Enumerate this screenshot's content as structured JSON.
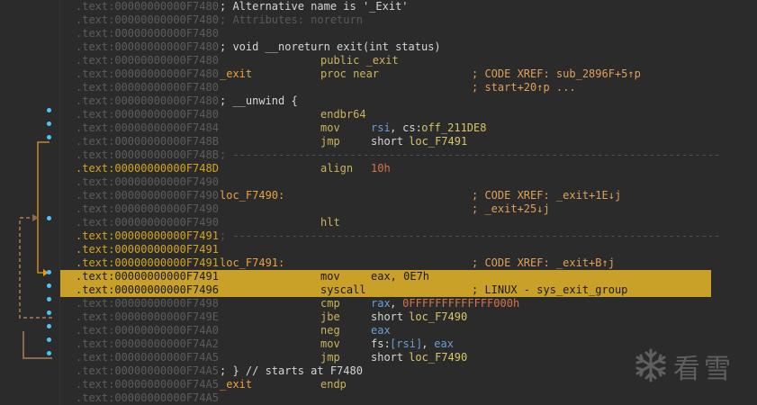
{
  "colors": {
    "background": "#2b2b2b",
    "address": "#5c5c5c",
    "address_highlight": "#d4a61c",
    "label": "#e8a23c",
    "register": "#6b9fd4",
    "number": "#d7724a",
    "highlight_bar": "#c9a028",
    "flow_dot": "#4fc3f7"
  },
  "rows": [
    {
      "addr": ".text:00000000000F7480",
      "a": "; Alternative name is '_Exit'"
    },
    {
      "addr": ".text:00000000000F7480",
      "a": "; Attributes: noreturn"
    },
    {
      "addr": ".text:00000000000F7480"
    },
    {
      "addr": ".text:00000000000F7480",
      "a": "; void __noreturn exit(int status)"
    },
    {
      "addr": ".text:00000000000F7480",
      "b": "public _exit"
    },
    {
      "addr": ".text:00000000000F7480",
      "a": "_exit",
      "b": "proc near",
      "d": "; CODE XREF: sub_2896F+5↑p"
    },
    {
      "addr": ".text:00000000000F7480",
      "d": "; start+20↑p ..."
    },
    {
      "addr": ".text:00000000000F7480",
      "a": "; __unwind {"
    },
    {
      "addr": ".text:00000000000F7480",
      "b": "endbr64"
    },
    {
      "addr": ".text:00000000000F7484",
      "b": "mov",
      "c1": "rsi",
      "c2": ", ",
      "c3": "cs:",
      "c4": "off_211DE8"
    },
    {
      "addr": ".text:00000000000F748B",
      "b": "jmp",
      "c1": "short ",
      "c2": "loc_F7491"
    },
    {
      "addr": ".text:00000000000F748B",
      "a": "; ---------------------------------------------------------------------------"
    },
    {
      "addr": ".text:00000000000F748D",
      "b": "align",
      "c1": "10h"
    },
    {
      "addr": ".text:00000000000F7490"
    },
    {
      "addr": ".text:00000000000F7490",
      "a": "loc_F7490:",
      "d": "; CODE XREF: _exit+1E↓j"
    },
    {
      "addr": ".text:00000000000F7490",
      "d": "; _exit+25↓j"
    },
    {
      "addr": ".text:00000000000F7490",
      "b": "hlt"
    },
    {
      "addr": ".text:00000000000F7491",
      "a": "; ---------------------------------------------------------------------------"
    },
    {
      "addr": ".text:00000000000F7491"
    },
    {
      "addr": ".text:00000000000F7491",
      "a": "loc_F7491:",
      "d": "; CODE XREF: _exit+B↑j"
    },
    {
      "addr": ".text:00000000000F7491",
      "b": "mov",
      "c1": "eax, 0E7h"
    },
    {
      "addr": ".text:00000000000F7496",
      "b": "syscall",
      "d": "; LINUX - sys_exit_group"
    },
    {
      "addr": ".text:00000000000F7498",
      "b": "cmp",
      "c1": "rax",
      "c2": ", ",
      "c3": "0FFFFFFFFFFFFF000h"
    },
    {
      "addr": ".text:00000000000F749E",
      "b": "jbe",
      "c1": "short ",
      "c2": "loc_F7490"
    },
    {
      "addr": ".text:00000000000F74A0",
      "b": "neg",
      "c1": "eax"
    },
    {
      "addr": ".text:00000000000F74A2",
      "b": "mov",
      "c1": "fs:",
      "c2": "[rsi]",
      "c3": ", ",
      "c4": "eax"
    },
    {
      "addr": ".text:00000000000F74A5",
      "b": "jmp",
      "c1": "short ",
      "c2": "loc_F7490"
    },
    {
      "addr": ".text:00000000000F74A5",
      "a": "; } // starts at F7480"
    },
    {
      "addr": ".text:00000000000F74A5",
      "a": "_exit",
      "b": "endp"
    },
    {
      "addr": ".text:00000000000F74A5"
    }
  ],
  "watermark": {
    "text": "看雪"
  }
}
